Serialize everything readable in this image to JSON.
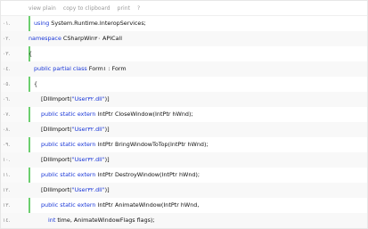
{
  "toolbar": {
    "view_plain": "view plain",
    "copy_to_clipboard": "copy to clipboard",
    "print": "print",
    "help": "?"
  },
  "lines": [
    {
      "num": "٠١.",
      "parts": [
        {
          "t": "kw",
          "v": "using "
        },
        {
          "t": "pl",
          "v": "System.Runtime.InteropServices;"
        }
      ]
    },
    {
      "num": "٠٢.",
      "parts": [
        {
          "t": "kw",
          "v": "namespace "
        },
        {
          "t": "pl",
          "v": "CSharpWin٢٠ APICall"
        }
      ]
    },
    {
      "num": "٠٣.",
      "parts": [
        {
          "t": "pl",
          "v": "{"
        }
      ]
    },
    {
      "num": "٠٤.",
      "parts": [
        {
          "t": "kw",
          "v": "public "
        },
        {
          "t": "kw",
          "v": "partial "
        },
        {
          "t": "kw",
          "v": "class "
        },
        {
          "t": "pl",
          "v": "Form١ : Form"
        }
      ]
    },
    {
      "num": "٠٥.",
      "parts": [
        {
          "t": "pl",
          "v": "{"
        }
      ]
    },
    {
      "num": "٠٦.",
      "parts": [
        {
          "t": "pl",
          "v": "[DllImport("
        },
        {
          "t": "str",
          "v": "\"User٣٢.dll\""
        },
        {
          "t": "pl",
          "v": ")]"
        }
      ]
    },
    {
      "num": "٠٧.",
      "parts": [
        {
          "t": "kw",
          "v": "public "
        },
        {
          "t": "kw",
          "v": "static "
        },
        {
          "t": "kw",
          "v": "extern "
        },
        {
          "t": "pl",
          "v": "IntPtr CloseWindow(IntPtr hWnd);"
        }
      ]
    },
    {
      "num": "٠٨.",
      "parts": [
        {
          "t": "pl",
          "v": "[DllImport("
        },
        {
          "t": "str",
          "v": "\"User٣٢.dll\""
        },
        {
          "t": "pl",
          "v": ")]"
        }
      ]
    },
    {
      "num": "٠٩.",
      "parts": [
        {
          "t": "kw",
          "v": "public "
        },
        {
          "t": "kw",
          "v": "static "
        },
        {
          "t": "kw",
          "v": "extern "
        },
        {
          "t": "pl",
          "v": "IntPtr BringWindowToTop(IntPtr hWnd);"
        }
      ]
    },
    {
      "num": "١٠.",
      "parts": [
        {
          "t": "pl",
          "v": "[DllImport("
        },
        {
          "t": "str",
          "v": "\"User٣٢.dll\""
        },
        {
          "t": "pl",
          "v": ")]"
        }
      ]
    },
    {
      "num": "١١.",
      "parts": [
        {
          "t": "kw",
          "v": "public "
        },
        {
          "t": "kw",
          "v": "static "
        },
        {
          "t": "kw",
          "v": "extern "
        },
        {
          "t": "pl",
          "v": "IntPtr DestroyWindow(IntPtr hWnd);"
        }
      ]
    },
    {
      "num": "١٢.",
      "parts": [
        {
          "t": "pl",
          "v": "[DllImport("
        },
        {
          "t": "str",
          "v": "\"User٣٢.dll\""
        },
        {
          "t": "pl",
          "v": ")]"
        }
      ]
    },
    {
      "num": "١٣.",
      "parts": [
        {
          "t": "kw",
          "v": "public "
        },
        {
          "t": "kw",
          "v": "static "
        },
        {
          "t": "kw",
          "v": "extern "
        },
        {
          "t": "pl",
          "v": "IntPtr AnimateWindow(IntPtr hWnd,"
        }
      ]
    },
    {
      "num": "١٤.",
      "parts": [
        {
          "t": "kw",
          "v": "int "
        },
        {
          "t": "pl",
          "v": "time, AnimateWindowFlags flags);"
        }
      ]
    }
  ]
}
